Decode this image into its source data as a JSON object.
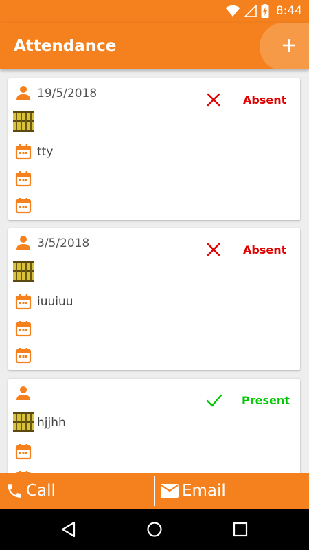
{
  "status_bar": {
    "time": "8:44",
    "icons": [
      "wifi-icon",
      "cell-signal-icon",
      "battery-charging-icon"
    ]
  },
  "app_bar": {
    "title": "Attendance",
    "add_icon": "plus-icon"
  },
  "records": [
    {
      "date": "19/5/2018",
      "status": "Absent",
      "status_icon": "cross-icon",
      "status_color": "#e00000",
      "note": "tty",
      "row3": "",
      "row4": ""
    },
    {
      "date": "3/5/2018",
      "status": "Absent",
      "status_icon": "cross-icon",
      "status_color": "#e00000",
      "note": "iuuiuu",
      "row3": "",
      "row4": ""
    },
    {
      "date": "",
      "status": "Present",
      "status_icon": "check-icon",
      "status_color": "#00c800",
      "note": "hjjhh",
      "row3": ""
    }
  ],
  "bottom_bar": {
    "call_label": "Call",
    "email_label": "Email"
  },
  "colors": {
    "accent": "#f5811e",
    "absent": "#e00000",
    "present": "#00c800"
  }
}
